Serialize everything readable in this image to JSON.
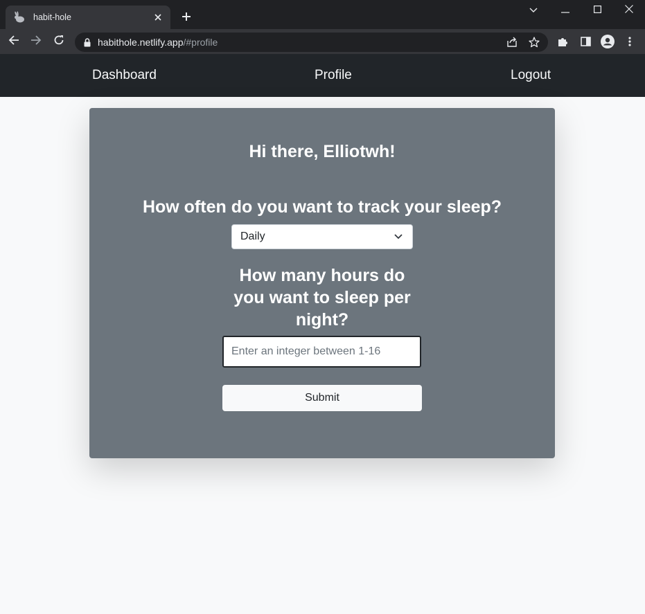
{
  "browser": {
    "tab_title": "habit-hole",
    "url_host": "habithole.netlify.app",
    "url_path": "/#profile",
    "icons": {
      "favicon": "rabbit-icon",
      "tab_close": "close-icon",
      "new_tab": "plus-icon",
      "back": "back-arrow-icon",
      "forward": "forward-arrow-icon",
      "reload": "reload-icon",
      "lock": "lock-icon",
      "share": "share-icon",
      "bookmark": "star-icon",
      "extensions": "puzzle-icon",
      "side_panel": "side-panel-icon",
      "profile": "avatar-icon",
      "menu": "kebab-menu-icon",
      "tab_search": "chevron-down-icon",
      "minimize": "minimize-icon",
      "maximize": "maximize-icon",
      "close_window": "close-window-icon"
    }
  },
  "navbar": {
    "dashboard": "Dashboard",
    "profile": "Profile",
    "logout": "Logout"
  },
  "profile": {
    "greeting": "Hi there, Elliotwh!",
    "frequency_question": "How often do you want to track your sleep?",
    "frequency_value": "Daily",
    "hours_question": "How many hours do you want to sleep per night?",
    "hours_placeholder": "Enter an integer between 1-16",
    "submit_label": "Submit"
  },
  "colors": {
    "navbar_bg": "#212529",
    "card_bg": "#6c757d",
    "page_bg": "#f8f9fa",
    "chrome_bg": "#202124",
    "toolbar_bg": "#35363a"
  }
}
